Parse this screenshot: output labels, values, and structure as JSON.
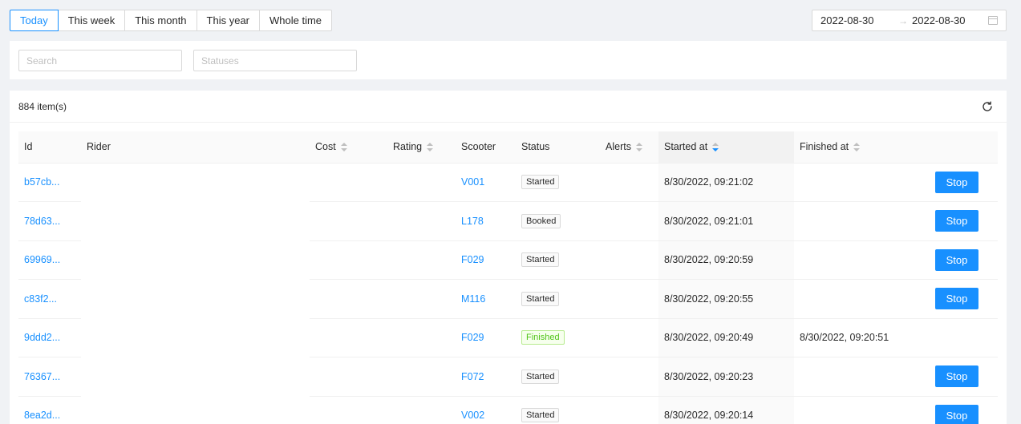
{
  "range_buttons": [
    {
      "label": "Today",
      "active": true
    },
    {
      "label": "This week",
      "active": false
    },
    {
      "label": "This month",
      "active": false
    },
    {
      "label": "This year",
      "active": false
    },
    {
      "label": "Whole time",
      "active": false
    }
  ],
  "date_range": {
    "start": "2022-08-30",
    "separator": "→",
    "end": "2022-08-30",
    "icon": "calendar-icon"
  },
  "filters": {
    "search_placeholder": "Search",
    "statuses_placeholder": "Statuses"
  },
  "table": {
    "item_count": "884 item(s)",
    "reload_icon": "reload-icon",
    "columns": {
      "id": "Id",
      "rider": "Rider",
      "cost": "Cost",
      "rating": "Rating",
      "scooter": "Scooter",
      "status": "Status",
      "alerts": "Alerts",
      "started_at": "Started at",
      "finished_at": "Finished at"
    },
    "sorted_column": "started_at",
    "sort_direction": "descending",
    "stop_label": "Stop",
    "rows": [
      {
        "id": "b57cb...",
        "scooter": "V001",
        "status": "Started",
        "started_at": "8/30/2022, 09:21:02",
        "finished_at": "",
        "has_stop": true
      },
      {
        "id": "78d63...",
        "scooter": "L178",
        "status": "Booked",
        "started_at": "8/30/2022, 09:21:01",
        "finished_at": "",
        "has_stop": true
      },
      {
        "id": "69969...",
        "scooter": "F029",
        "status": "Started",
        "started_at": "8/30/2022, 09:20:59",
        "finished_at": "",
        "has_stop": true
      },
      {
        "id": "c83f2...",
        "scooter": "M116",
        "status": "Started",
        "started_at": "8/30/2022, 09:20:55",
        "finished_at": "",
        "has_stop": true
      },
      {
        "id": "9ddd2...",
        "scooter": "F029",
        "status": "Finished",
        "started_at": "8/30/2022, 09:20:49",
        "finished_at": "8/30/2022, 09:20:51",
        "has_stop": false
      },
      {
        "id": "76367...",
        "scooter": "F072",
        "status": "Started",
        "started_at": "8/30/2022, 09:20:23",
        "finished_at": "",
        "has_stop": true
      },
      {
        "id": "8ea2d...",
        "scooter": "V002",
        "status": "Started",
        "started_at": "8/30/2022, 09:20:14",
        "finished_at": "",
        "has_stop": true
      }
    ]
  },
  "colors": {
    "primary": "#1890ff",
    "finished_green": "#52c41a",
    "background": "#f0f2f5"
  }
}
